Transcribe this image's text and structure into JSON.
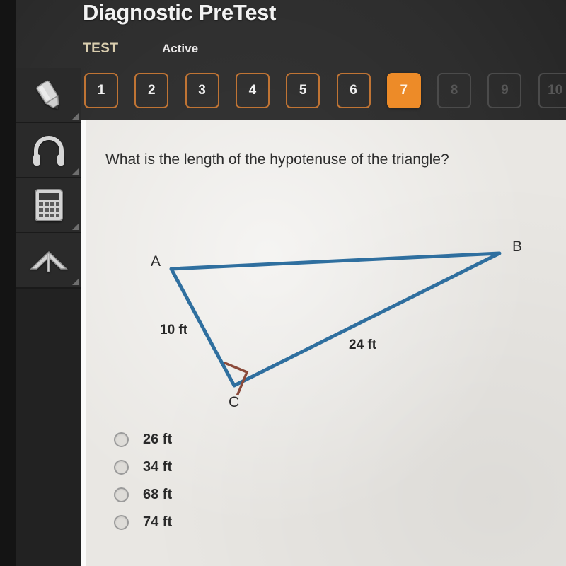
{
  "header": {
    "title": "Diagnostic PreTest",
    "test_label": "TEST",
    "status_label": "Active"
  },
  "tabs": {
    "items": [
      {
        "label": "1",
        "state": "available"
      },
      {
        "label": "2",
        "state": "available"
      },
      {
        "label": "3",
        "state": "available"
      },
      {
        "label": "4",
        "state": "available"
      },
      {
        "label": "5",
        "state": "available"
      },
      {
        "label": "6",
        "state": "available"
      },
      {
        "label": "7",
        "state": "current"
      },
      {
        "label": "8",
        "state": "locked"
      },
      {
        "label": "9",
        "state": "locked"
      },
      {
        "label": "10",
        "state": "locked"
      }
    ]
  },
  "toolbar": {
    "items": [
      {
        "icon": "highlighter-icon",
        "name": "highlighter-tool"
      },
      {
        "icon": "headphones-icon",
        "name": "audio-tool"
      },
      {
        "icon": "calculator-icon",
        "name": "calculator-tool"
      },
      {
        "icon": "protractor-icon",
        "name": "protractor-tool"
      }
    ]
  },
  "question": {
    "text": "What is the length of the hypotenuse of the triangle?"
  },
  "figure": {
    "vertices": [
      {
        "label": "A"
      },
      {
        "label": "B"
      },
      {
        "label": "C"
      }
    ],
    "side_labels": [
      {
        "label": "10 ft"
      },
      {
        "label": "24 ft"
      }
    ],
    "right_angle_at": "C",
    "line_color": "#2f6f9f",
    "angle_marker_color": "#8b4a3a"
  },
  "options": {
    "items": [
      {
        "label": "26 ft",
        "selected": false
      },
      {
        "label": "34 ft",
        "selected": false
      },
      {
        "label": "68 ft",
        "selected": false
      },
      {
        "label": "74 ft",
        "selected": false
      }
    ]
  },
  "colors": {
    "accent": "#ed8b28",
    "tab_outline": "#c07434",
    "panel_bg": "#e9e7e3",
    "chrome_bg": "#2e2e2e"
  }
}
